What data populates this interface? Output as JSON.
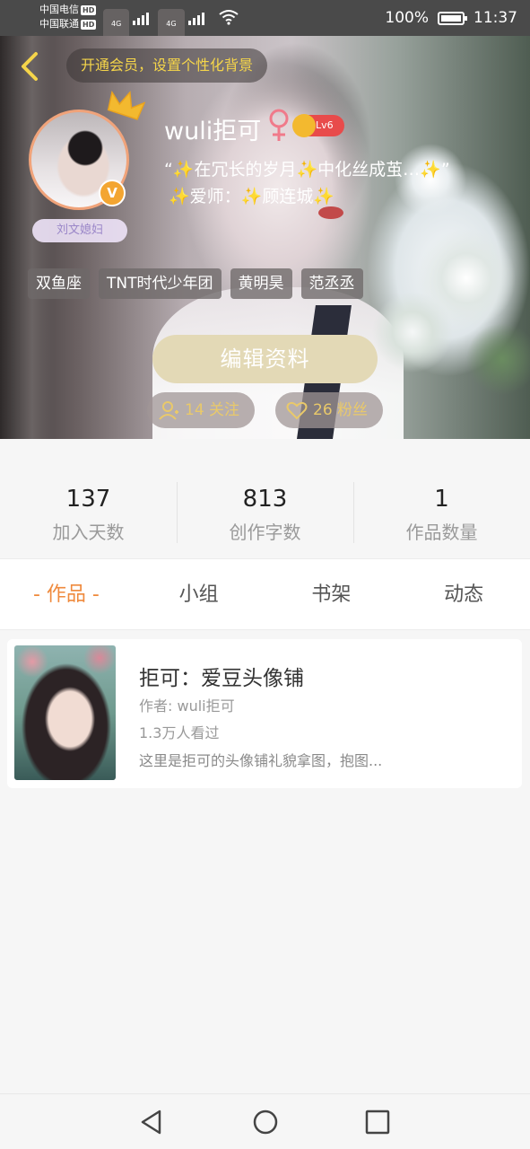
{
  "status_bar": {
    "carrier_1": "中国电信",
    "carrier_2": "中国联通",
    "hd": "HD",
    "network": "4G",
    "battery": "100%",
    "time": "11:37"
  },
  "header": {
    "member_prompt": "开通会员，设置个性化背景",
    "username": "wuli拒可",
    "gender_symbol": "♀",
    "level": "Lv6",
    "verified_mark": "V",
    "title_badge": "刘文媳妇",
    "signature_1": "“✨在冗长的岁月✨中化丝成茧…✨”",
    "signature_2": "✨爱师：✨顾连城✨",
    "tags": [
      "双鱼座",
      "TNT时代少年团",
      "黄明昊",
      "范丞丞"
    ],
    "edit_button": "编辑资料",
    "following": "14 关注",
    "followers": "26 粉丝"
  },
  "stats": [
    {
      "value": "137",
      "label": "加入天数"
    },
    {
      "value": "813",
      "label": "创作字数"
    },
    {
      "value": "1",
      "label": "作品数量"
    }
  ],
  "tabs": [
    "- 作品 -",
    "小组",
    "书架",
    "动态"
  ],
  "works": [
    {
      "title": "拒可：爱豆头像铺",
      "author": "作者: wuli拒可",
      "views": "1.3万人看过",
      "desc": "这里是拒可的头像铺礼貌拿图，抱图..."
    }
  ],
  "colors": {
    "accent": "#ef8a3d",
    "gold": "#f5d54a",
    "level_red": "#e84b4b"
  }
}
